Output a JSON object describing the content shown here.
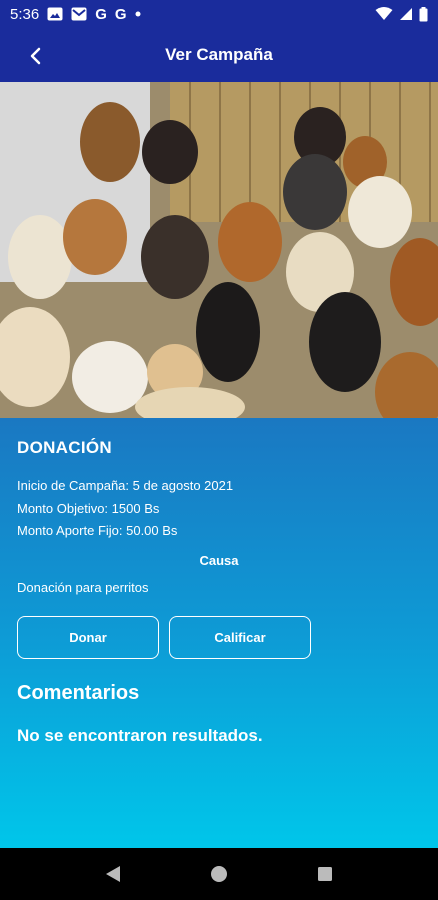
{
  "status_bar": {
    "time": "5:36",
    "icons_left": [
      "image-icon",
      "mail-icon",
      "google-icon",
      "google-icon",
      "dot-icon"
    ],
    "google_letter": "G",
    "icons_right": [
      "wifi-icon",
      "signal-icon",
      "battery-icon"
    ]
  },
  "app_bar": {
    "title": "Ver Campaña",
    "back_icon": "arrow-back-icon"
  },
  "hero": {
    "image": "group-of-dogs-photo"
  },
  "campaign": {
    "section_title": "DONACIÓN",
    "start_date": "Inicio de Campaña: 5 de agosto 2021",
    "goal": "Monto Objetivo: 1500 Bs",
    "fixed_contribution": "Monto Aporte Fijo: 50.00 Bs",
    "cause_label": "Causa",
    "cause_text": "Donación para perritos"
  },
  "actions": {
    "donate_label": "Donar",
    "rate_label": "Calificar"
  },
  "comments": {
    "title": "Comentarios",
    "empty_message": "No se encontraron resultados."
  },
  "nav_bar": {
    "items": [
      "back-triangle-icon",
      "home-circle-icon",
      "recents-square-icon"
    ]
  },
  "colors": {
    "app_bar": "#1a2c9c",
    "gradient_top": "#1a78c2",
    "gradient_bottom": "#00c6ea"
  }
}
